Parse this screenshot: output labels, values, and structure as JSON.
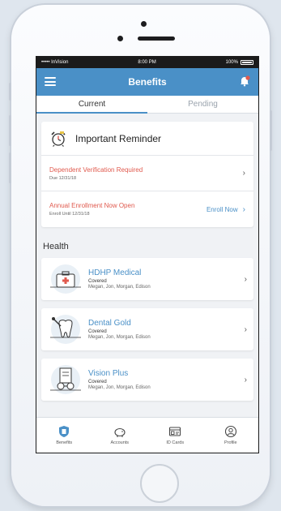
{
  "status_bar": {
    "carrier": "••••• InVision",
    "time": "8:00 PM",
    "battery": "100%"
  },
  "header": {
    "title": "Benefits",
    "menu_icon": "menu-icon",
    "notification_icon": "bell-icon"
  },
  "tabs": [
    {
      "label": "Current",
      "active": true
    },
    {
      "label": "Pending",
      "active": false
    }
  ],
  "reminder": {
    "title": "Important Reminder",
    "icon": "alarm-clock-icon",
    "items": [
      {
        "title": "Dependent Verification Required",
        "subtitle": "Due 12/31/18"
      },
      {
        "title": "Annual Enrollment Now Open",
        "subtitle": "Enroll Until 12/31/18",
        "action": "Enroll Now"
      }
    ]
  },
  "health": {
    "section_title": "Health",
    "plans": [
      {
        "name": "HDHP Medical",
        "status": "Covered",
        "members": "Megan, Jon, Morgan, Edison",
        "icon": "medical-kit-icon"
      },
      {
        "name": "Dental Gold",
        "status": "Covered",
        "members": "Megan, Jon, Morgan, Edison",
        "icon": "tooth-icon"
      },
      {
        "name": "Vision Plus",
        "status": "Covered",
        "members": "Megan, Jon, Morgan, Edison",
        "icon": "eyeglasses-icon"
      }
    ]
  },
  "bottom_nav": [
    {
      "label": "Benefits",
      "icon": "shield-icon",
      "active": true
    },
    {
      "label": "Accounts",
      "icon": "piggy-bank-icon",
      "active": false
    },
    {
      "label": "ID Cards",
      "icon": "id-card-icon",
      "active": false
    },
    {
      "label": "Profile",
      "icon": "profile-icon",
      "active": false
    }
  ],
  "colors": {
    "primary": "#4a90c7",
    "alert": "#e05a4e",
    "background": "#f0f2f5"
  }
}
